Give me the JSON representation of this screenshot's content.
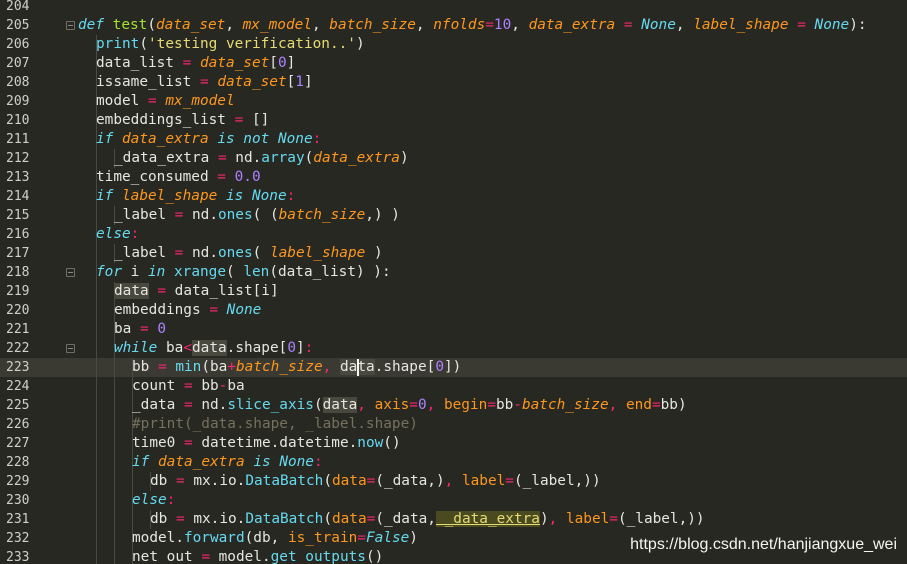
{
  "editor": {
    "lines": [
      {
        "num": "204",
        "tokens": []
      },
      {
        "num": "205",
        "fold": true,
        "indent": 0,
        "tokens": [
          {
            "c": "kw",
            "t": "def"
          },
          {
            "c": "plain",
            "t": " "
          },
          {
            "c": "fn",
            "t": "test"
          },
          {
            "c": "plain",
            "t": "("
          },
          {
            "c": "param",
            "t": "data_set"
          },
          {
            "c": "plain",
            "t": ", "
          },
          {
            "c": "param",
            "t": "mx_model"
          },
          {
            "c": "plain",
            "t": ", "
          },
          {
            "c": "param",
            "t": "batch_size"
          },
          {
            "c": "plain",
            "t": ", "
          },
          {
            "c": "param",
            "t": "nfolds"
          },
          {
            "c": "op",
            "t": "="
          },
          {
            "c": "num",
            "t": "10"
          },
          {
            "c": "plain",
            "t": ", "
          },
          {
            "c": "param",
            "t": "data_extra"
          },
          {
            "c": "plain",
            "t": " "
          },
          {
            "c": "op",
            "t": "="
          },
          {
            "c": "plain",
            "t": " "
          },
          {
            "c": "const",
            "t": "None"
          },
          {
            "c": "plain",
            "t": ", "
          },
          {
            "c": "param",
            "t": "label_shape"
          },
          {
            "c": "plain",
            "t": " "
          },
          {
            "c": "op",
            "t": "="
          },
          {
            "c": "plain",
            "t": " "
          },
          {
            "c": "const",
            "t": "None"
          },
          {
            "c": "plain",
            "t": "):"
          }
        ]
      },
      {
        "num": "206",
        "indent": 1,
        "tokens": [
          {
            "c": "bi",
            "t": "print"
          },
          {
            "c": "plain",
            "t": "("
          },
          {
            "c": "str",
            "t": "'testing verification..'"
          },
          {
            "c": "plain",
            "t": ")"
          }
        ]
      },
      {
        "num": "207",
        "indent": 1,
        "tokens": [
          {
            "c": "plain",
            "t": "data_list "
          },
          {
            "c": "op",
            "t": "="
          },
          {
            "c": "plain",
            "t": " "
          },
          {
            "c": "param",
            "t": "data_set"
          },
          {
            "c": "plain",
            "t": "["
          },
          {
            "c": "num",
            "t": "0"
          },
          {
            "c": "plain",
            "t": "]"
          }
        ]
      },
      {
        "num": "208",
        "indent": 1,
        "tokens": [
          {
            "c": "plain",
            "t": "issame_list "
          },
          {
            "c": "op",
            "t": "="
          },
          {
            "c": "plain",
            "t": " "
          },
          {
            "c": "param",
            "t": "data_set"
          },
          {
            "c": "plain",
            "t": "["
          },
          {
            "c": "num",
            "t": "1"
          },
          {
            "c": "plain",
            "t": "]"
          }
        ]
      },
      {
        "num": "209",
        "indent": 1,
        "tokens": [
          {
            "c": "plain",
            "t": "model "
          },
          {
            "c": "op",
            "t": "="
          },
          {
            "c": "plain",
            "t": " "
          },
          {
            "c": "param",
            "t": "mx_model"
          }
        ]
      },
      {
        "num": "210",
        "indent": 1,
        "tokens": [
          {
            "c": "plain",
            "t": "embeddings_list "
          },
          {
            "c": "op",
            "t": "="
          },
          {
            "c": "plain",
            "t": " []"
          }
        ]
      },
      {
        "num": "211",
        "indent": 1,
        "tokens": [
          {
            "c": "kw",
            "t": "if"
          },
          {
            "c": "plain",
            "t": " "
          },
          {
            "c": "param",
            "t": "data_extra"
          },
          {
            "c": "plain",
            "t": " "
          },
          {
            "c": "kw",
            "t": "is not"
          },
          {
            "c": "plain",
            "t": " "
          },
          {
            "c": "const",
            "t": "None"
          },
          {
            "c": "op",
            "t": ":"
          }
        ]
      },
      {
        "num": "212",
        "indent": 2,
        "tokens": [
          {
            "c": "plain",
            "t": "_data_extra "
          },
          {
            "c": "op",
            "t": "="
          },
          {
            "c": "plain",
            "t": " nd."
          },
          {
            "c": "attr",
            "t": "array"
          },
          {
            "c": "plain",
            "t": "("
          },
          {
            "c": "param",
            "t": "data_extra"
          },
          {
            "c": "plain",
            "t": ")"
          }
        ]
      },
      {
        "num": "213",
        "indent": 1,
        "tokens": [
          {
            "c": "plain",
            "t": "time_consumed "
          },
          {
            "c": "op",
            "t": "="
          },
          {
            "c": "plain",
            "t": " "
          },
          {
            "c": "num",
            "t": "0.0"
          }
        ]
      },
      {
        "num": "214",
        "indent": 1,
        "tokens": [
          {
            "c": "kw",
            "t": "if"
          },
          {
            "c": "plain",
            "t": " "
          },
          {
            "c": "param",
            "t": "label_shape"
          },
          {
            "c": "plain",
            "t": " "
          },
          {
            "c": "kw",
            "t": "is"
          },
          {
            "c": "plain",
            "t": " "
          },
          {
            "c": "const",
            "t": "None"
          },
          {
            "c": "op",
            "t": ":"
          }
        ]
      },
      {
        "num": "215",
        "indent": 2,
        "tokens": [
          {
            "c": "plain",
            "t": "_label "
          },
          {
            "c": "op",
            "t": "="
          },
          {
            "c": "plain",
            "t": " nd."
          },
          {
            "c": "attr",
            "t": "ones"
          },
          {
            "c": "plain",
            "t": "( ("
          },
          {
            "c": "param",
            "t": "batch_size"
          },
          {
            "c": "plain",
            "t": ",) )"
          }
        ]
      },
      {
        "num": "216",
        "indent": 1,
        "tokens": [
          {
            "c": "kw",
            "t": "else"
          },
          {
            "c": "op",
            "t": ":"
          }
        ]
      },
      {
        "num": "217",
        "indent": 2,
        "tokens": [
          {
            "c": "plain",
            "t": "_label "
          },
          {
            "c": "op",
            "t": "="
          },
          {
            "c": "plain",
            "t": " nd."
          },
          {
            "c": "attr",
            "t": "ones"
          },
          {
            "c": "plain",
            "t": "( "
          },
          {
            "c": "param",
            "t": "label_shape"
          },
          {
            "c": "plain",
            "t": " )"
          }
        ]
      },
      {
        "num": "218",
        "fold": true,
        "indent": 1,
        "tokens": [
          {
            "c": "kw",
            "t": "for"
          },
          {
            "c": "plain",
            "t": " i "
          },
          {
            "c": "kw",
            "t": "in"
          },
          {
            "c": "plain",
            "t": " "
          },
          {
            "c": "bi",
            "t": "xrange"
          },
          {
            "c": "plain",
            "t": "( "
          },
          {
            "c": "bi",
            "t": "len"
          },
          {
            "c": "plain",
            "t": "(data_list) "
          },
          {
            "c": "plain",
            "t": "):"
          }
        ]
      },
      {
        "num": "219",
        "indent": 2,
        "tokens": [
          {
            "c": "hl",
            "t": "data"
          },
          {
            "c": "plain",
            "t": " "
          },
          {
            "c": "op",
            "t": "="
          },
          {
            "c": "plain",
            "t": " data_list[i]"
          }
        ]
      },
      {
        "num": "220",
        "indent": 2,
        "tokens": [
          {
            "c": "plain",
            "t": "embeddings "
          },
          {
            "c": "op",
            "t": "="
          },
          {
            "c": "plain",
            "t": " "
          },
          {
            "c": "const",
            "t": "None"
          }
        ]
      },
      {
        "num": "221",
        "indent": 2,
        "tokens": [
          {
            "c": "plain",
            "t": "ba "
          },
          {
            "c": "op",
            "t": "="
          },
          {
            "c": "plain",
            "t": " "
          },
          {
            "c": "num",
            "t": "0"
          }
        ]
      },
      {
        "num": "222",
        "fold": true,
        "indent": 2,
        "tokens": [
          {
            "c": "kw",
            "t": "while"
          },
          {
            "c": "plain",
            "t": " ba"
          },
          {
            "c": "op",
            "t": "<"
          },
          {
            "c": "hl",
            "t": "data"
          },
          {
            "c": "plain",
            "t": ".shape["
          },
          {
            "c": "num",
            "t": "0"
          },
          {
            "c": "plain",
            "t": "]"
          },
          {
            "c": "op",
            "t": ":"
          }
        ]
      },
      {
        "num": "223",
        "current": true,
        "indent": 3,
        "tokens": [
          {
            "c": "plain",
            "t": "bb "
          },
          {
            "c": "op",
            "t": "="
          },
          {
            "c": "plain",
            "t": " "
          },
          {
            "c": "bi",
            "t": "min"
          },
          {
            "c": "plain",
            "t": "(ba"
          },
          {
            "c": "op",
            "t": "+"
          },
          {
            "c": "param",
            "t": "batch_size"
          },
          {
            "c": "op",
            "t": ","
          },
          {
            "c": "plain",
            "t": " "
          },
          {
            "c": "hl",
            "t": "data"
          },
          {
            "c": "plain",
            "t": ".shape["
          },
          {
            "c": "num",
            "t": "0"
          },
          {
            "c": "plain",
            "t": "])"
          }
        ]
      },
      {
        "num": "224",
        "indent": 3,
        "tokens": [
          {
            "c": "plain",
            "t": "count "
          },
          {
            "c": "op",
            "t": "="
          },
          {
            "c": "plain",
            "t": " bb"
          },
          {
            "c": "op",
            "t": "-"
          },
          {
            "c": "plain",
            "t": "ba"
          }
        ]
      },
      {
        "num": "225",
        "indent": 3,
        "tokens": [
          {
            "c": "plain",
            "t": "_data "
          },
          {
            "c": "op",
            "t": "="
          },
          {
            "c": "plain",
            "t": " nd."
          },
          {
            "c": "attr",
            "t": "slice_axis"
          },
          {
            "c": "plain",
            "t": "("
          },
          {
            "c": "hl",
            "t": "data"
          },
          {
            "c": "op",
            "t": ","
          },
          {
            "c": "plain",
            "t": " "
          },
          {
            "c": "kwarg",
            "t": "axis"
          },
          {
            "c": "op",
            "t": "="
          },
          {
            "c": "num",
            "t": "0"
          },
          {
            "c": "op",
            "t": ","
          },
          {
            "c": "plain",
            "t": " "
          },
          {
            "c": "kwarg",
            "t": "begin"
          },
          {
            "c": "op",
            "t": "="
          },
          {
            "c": "plain",
            "t": "bb"
          },
          {
            "c": "op",
            "t": "-"
          },
          {
            "c": "param",
            "t": "batch_size"
          },
          {
            "c": "op",
            "t": ","
          },
          {
            "c": "plain",
            "t": " "
          },
          {
            "c": "kwarg",
            "t": "end"
          },
          {
            "c": "op",
            "t": "="
          },
          {
            "c": "plain",
            "t": "bb)"
          }
        ]
      },
      {
        "num": "226",
        "indent": 3,
        "tokens": [
          {
            "c": "com",
            "t": "#print(_data.shape, _label.shape)"
          }
        ]
      },
      {
        "num": "227",
        "indent": 3,
        "tokens": [
          {
            "c": "plain",
            "t": "time0 "
          },
          {
            "c": "op",
            "t": "="
          },
          {
            "c": "plain",
            "t": " datetime.datetime."
          },
          {
            "c": "attr",
            "t": "now"
          },
          {
            "c": "plain",
            "t": "()"
          }
        ]
      },
      {
        "num": "228",
        "indent": 3,
        "tokens": [
          {
            "c": "kw",
            "t": "if"
          },
          {
            "c": "plain",
            "t": " "
          },
          {
            "c": "param",
            "t": "data_extra"
          },
          {
            "c": "plain",
            "t": " "
          },
          {
            "c": "kw",
            "t": "is"
          },
          {
            "c": "plain",
            "t": " "
          },
          {
            "c": "const",
            "t": "None"
          },
          {
            "c": "op",
            "t": ":"
          }
        ]
      },
      {
        "num": "229",
        "indent": 4,
        "tokens": [
          {
            "c": "plain",
            "t": "db "
          },
          {
            "c": "op",
            "t": "="
          },
          {
            "c": "plain",
            "t": " mx.io."
          },
          {
            "c": "attr",
            "t": "DataBatch"
          },
          {
            "c": "plain",
            "t": "("
          },
          {
            "c": "kwarg",
            "t": "data"
          },
          {
            "c": "op",
            "t": "="
          },
          {
            "c": "plain",
            "t": "(_data,)"
          },
          {
            "c": "op",
            "t": ","
          },
          {
            "c": "plain",
            "t": " "
          },
          {
            "c": "kwarg",
            "t": "label"
          },
          {
            "c": "op",
            "t": "="
          },
          {
            "c": "plain",
            "t": "(_label,))"
          }
        ]
      },
      {
        "num": "230",
        "indent": 3,
        "tokens": [
          {
            "c": "kw",
            "t": "else"
          },
          {
            "c": "op",
            "t": ":"
          }
        ]
      },
      {
        "num": "231",
        "indent": 4,
        "tokens": [
          {
            "c": "plain",
            "t": "db "
          },
          {
            "c": "op",
            "t": "="
          },
          {
            "c": "plain",
            "t": " mx.io."
          },
          {
            "c": "attr",
            "t": "DataBatch"
          },
          {
            "c": "plain",
            "t": "("
          },
          {
            "c": "kwarg",
            "t": "data"
          },
          {
            "c": "op",
            "t": "="
          },
          {
            "c": "plain",
            "t": "(_data,"
          },
          {
            "c": "hl2",
            "t": " _data_extra"
          },
          {
            "c": "plain",
            "t": ")"
          },
          {
            "c": "op",
            "t": ","
          },
          {
            "c": "plain",
            "t": " "
          },
          {
            "c": "kwarg",
            "t": "label"
          },
          {
            "c": "op",
            "t": "="
          },
          {
            "c": "plain",
            "t": "(_label,))"
          }
        ]
      },
      {
        "num": "232",
        "indent": 3,
        "tokens": [
          {
            "c": "plain",
            "t": "model."
          },
          {
            "c": "attr",
            "t": "forward"
          },
          {
            "c": "plain",
            "t": "(db, "
          },
          {
            "c": "kwarg",
            "t": "is_train"
          },
          {
            "c": "op",
            "t": "="
          },
          {
            "c": "const",
            "t": "False"
          },
          {
            "c": "plain",
            "t": ")"
          }
        ]
      },
      {
        "num": "233",
        "indent": 3,
        "tokens": [
          {
            "c": "plain",
            "t": "net_out "
          },
          {
            "c": "op",
            "t": "="
          },
          {
            "c": "plain",
            "t": " model."
          },
          {
            "c": "attr",
            "t": "get_outputs"
          },
          {
            "c": "plain",
            "t": "()"
          }
        ]
      }
    ]
  },
  "watermark": "https://blog.csdn.net/hanjiangxue_wei"
}
